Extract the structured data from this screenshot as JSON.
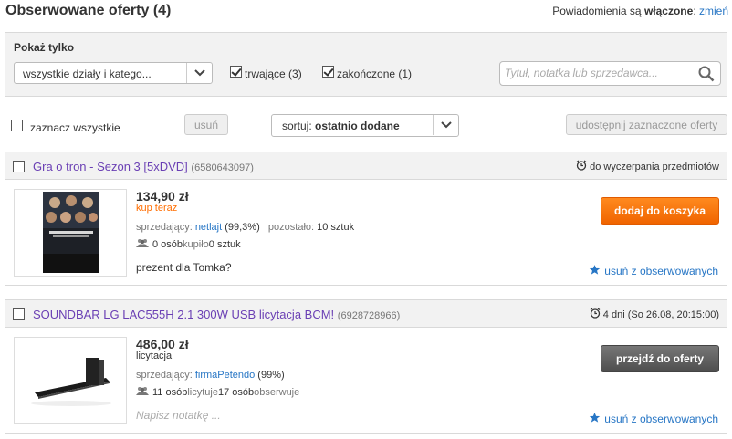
{
  "header": {
    "title": "Obserwowane oferty (4)",
    "notif_prefix": "Powiadomienia są ",
    "notif_state": "włączone",
    "notif_sep": ": ",
    "change_link": "zmień"
  },
  "filter": {
    "label": "Pokaż tylko",
    "category_select": "wszystkie działy i katego...",
    "ongoing_label": "trwające (3)",
    "ongoing_checked": true,
    "ended_label": "zakończone (1)",
    "ended_checked": true,
    "search_placeholder": "Tytuł, notatka lub sprzedawca..."
  },
  "toolbar": {
    "select_all_label": "zaznacz wszystkie",
    "remove_button": "usuń",
    "sort_prefix": "sortuj: ",
    "sort_value": "ostatnio dodane",
    "share_button": "udostępnij zaznaczone oferty"
  },
  "offers": [
    {
      "title": "Gra o tron - Sezon 3 [5xDVD]",
      "id": "(6580643097)",
      "time": "do wyczerpania przedmiotów",
      "price": "134,90 zł",
      "price_type": "kup teraz",
      "seller_label": "sprzedający: ",
      "seller": "netlajt",
      "seller_rating": " (99,3%)",
      "remaining_label": "pozostało: ",
      "remaining": "10 sztuk",
      "people": "0 osób",
      "people_action": " kupiło ",
      "people_count": "0 sztuk",
      "people_extra": "",
      "note": "prezent dla Tomka?",
      "action_button": "dodaj do koszyka",
      "unwatch": "usuń z obserwowanych",
      "accent": "#ff6d00"
    },
    {
      "title": "SOUNDBAR LG LAC555H 2.1 300W USB licytacja BCM!",
      "id": "(6928728966)",
      "time": "4 dni (So 26.08, 20:15:00)",
      "price": "486,00 zł",
      "price_type": "licytacja",
      "seller_label": "sprzedający: ",
      "seller": "firmaPetendo",
      "seller_rating": " (99%)",
      "people": "11 osób",
      "people_action": " licytuje ",
      "people_count": "17 osób",
      "people_extra": " obserwuje",
      "note_placeholder": "Napisz notatkę ...",
      "action_button": "przejdź do oferty",
      "unwatch": "usuń z obserwowanych",
      "accent": "#555555"
    }
  ],
  "colors": {
    "link": "#2776c5",
    "title_link": "#6a3fb4",
    "buy_now": "#ff6d00"
  }
}
